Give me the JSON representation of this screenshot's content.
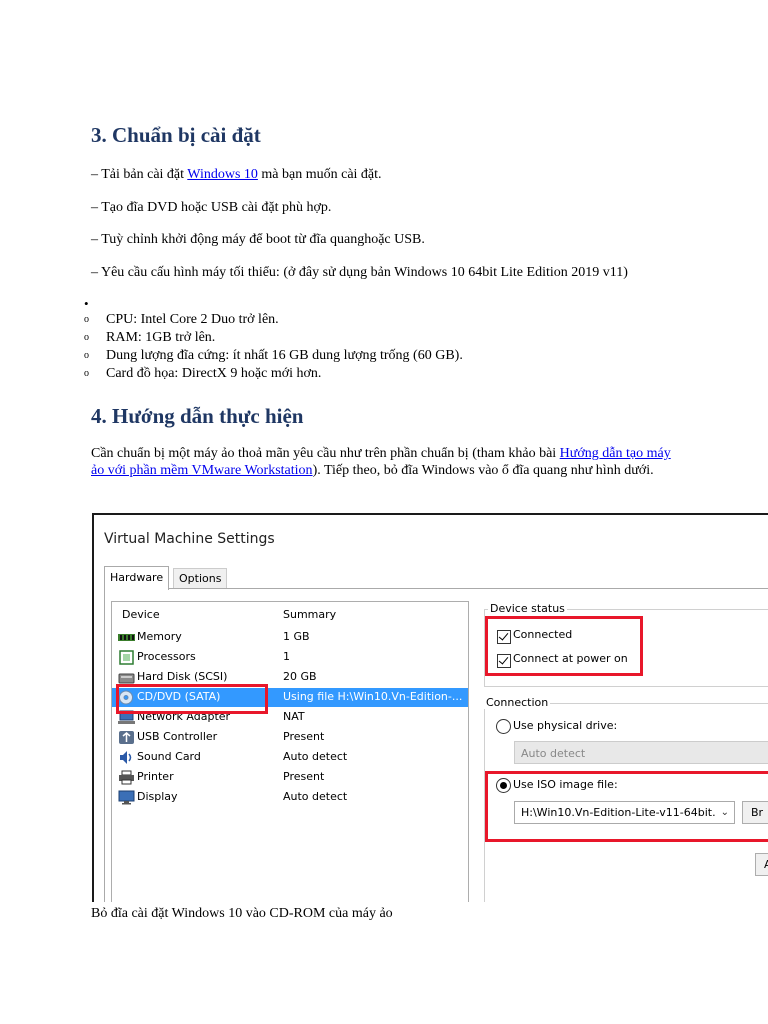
{
  "section3": {
    "heading": "3. Chuẩn bị cài đặt",
    "line1_pre": "– Tải bản cài đặt ",
    "line1_link": "Windows 10",
    "line1_post": " mà bạn muốn cài đặt.",
    "line2": "– Tạo đĩa DVD hoặc USB cài đặt phù hợp.",
    "line3": "– Tuỳ chỉnh khởi động máy để boot từ đĩa quanghoặc USB.",
    "line4": "– Yêu cầu cấu hình máy tối thiểu: (ở đây sử dụng bản Windows 10 64bit Lite Edition 2019 v11)",
    "bullet": "•",
    "sub_marker": "o",
    "requirements": [
      "CPU: Intel Core 2 Duo trở lên.",
      "RAM: 1GB trở lên.",
      "Dung lượng đĩa cứng: ít nhất 16 GB dung lượng trống (60 GB).",
      "Card đồ họa: DirectX 9 hoặc mới hơn."
    ]
  },
  "section4": {
    "heading": "4. Hướng dẫn thực hiện",
    "para_pre": "Cần chuẩn bị một máy ảo thoả mãn yêu cầu như trên phần chuẩn bị (tham khảo bài ",
    "para_link": "Hướng dẫn tạo máy ảo với phần mềm VMware Workstation",
    "para_post": "). Tiếp theo, bỏ đĩa Windows vào ổ đĩa quang như hình dưới."
  },
  "vm_settings": {
    "window_title": "Virtual Machine Settings",
    "tabs": [
      "Hardware",
      "Options"
    ],
    "columns": {
      "device": "Device",
      "summary": "Summary"
    },
    "devices": [
      {
        "name": "Memory",
        "summary": "1 GB",
        "icon": "memory-icon"
      },
      {
        "name": "Processors",
        "summary": "1",
        "icon": "processor-icon"
      },
      {
        "name": "Hard Disk (SCSI)",
        "summary": "20 GB",
        "icon": "hard-disk-icon"
      },
      {
        "name": "CD/DVD (SATA)",
        "summary": "Using file H:\\Win10.Vn-Edition-...",
        "icon": "cd-dvd-icon",
        "selected": true
      },
      {
        "name": "Network Adapter",
        "summary": "NAT",
        "icon": "network-adapter-icon"
      },
      {
        "name": "USB Controller",
        "summary": "Present",
        "icon": "usb-icon"
      },
      {
        "name": "Sound Card",
        "summary": "Auto detect",
        "icon": "sound-card-icon"
      },
      {
        "name": "Printer",
        "summary": "Present",
        "icon": "printer-icon"
      },
      {
        "name": "Display",
        "summary": "Auto detect",
        "icon": "display-icon"
      }
    ],
    "device_status": {
      "label": "Device status",
      "connected": "Connected",
      "connect_at_power_on": "Connect at power on",
      "connected_checked": true,
      "power_on_checked": true
    },
    "connection": {
      "label": "Connection",
      "physical_drive": "Use physical drive:",
      "physical_value": "Auto detect",
      "iso_image": "Use ISO image file:",
      "iso_value": "H:\\Win10.Vn-Edition-Lite-v11-64bit.",
      "browse": "Br",
      "advanced": "A",
      "selected": "iso"
    },
    "highlight_color": "#e8172a",
    "selection_color": "#3399ff"
  },
  "caption": "Bỏ đĩa cài đặt Windows 10 vào CD-ROM của máy ảo"
}
